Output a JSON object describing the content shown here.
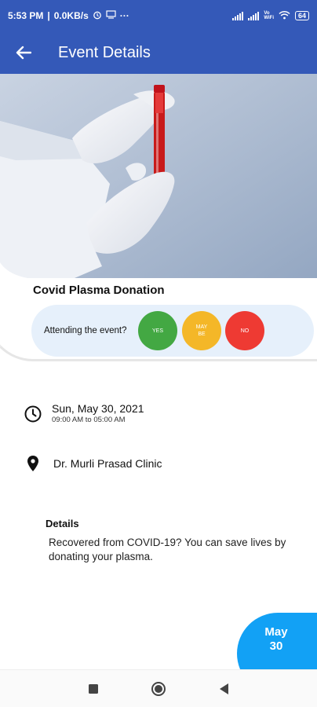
{
  "status_bar": {
    "time": "5:53 PM",
    "speed": "0.0KB/s",
    "separator": "|",
    "dots": "···",
    "vowifi_top": "Vo",
    "vowifi_bottom": "WiFi",
    "battery": "64"
  },
  "app_bar": {
    "title": "Event Details"
  },
  "event": {
    "title": "Covid Plasma Donation",
    "rsvp_prompt": "Attending the event?",
    "rsvp_yes": "YES",
    "rsvp_maybe_1": "MAY",
    "rsvp_maybe_2": "BE",
    "rsvp_no": "NO",
    "date": "Sun, May 30, 2021",
    "time_range": "09:00 AM to 05:00 AM",
    "location": "Dr. Murli Prasad Clinic",
    "details_heading": "Details",
    "details_body": "Recovered from COVID-19? You can save lives by donating your plasma.",
    "badge_month": "May",
    "badge_day": "30"
  },
  "colors": {
    "app_bar": "#3459b8",
    "yes": "#43a843",
    "maybe": "#f4b728",
    "no": "#ee3a33",
    "date_badge": "#12a1f5",
    "rsvp_box": "#e6f0fb"
  },
  "icons": {
    "back": "arrow-left-icon",
    "clock": "clock-icon",
    "location": "location-pin-icon",
    "nav_recents": "square-icon",
    "nav_home": "circle-icon",
    "nav_back": "triangle-back-icon"
  }
}
